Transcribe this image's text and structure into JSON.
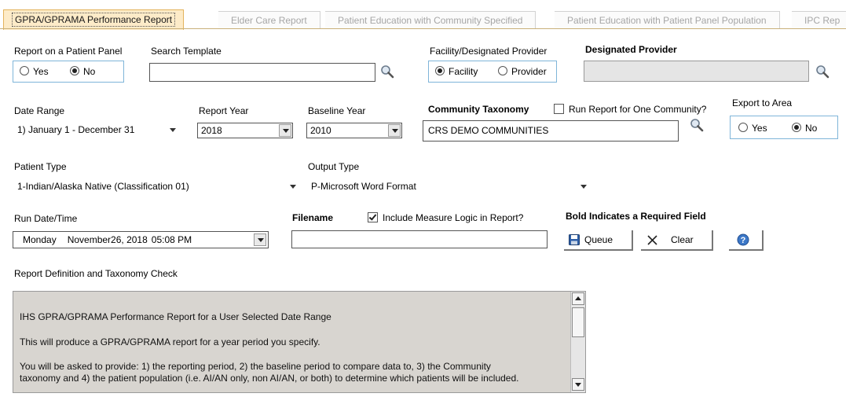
{
  "tabs": [
    {
      "label": "GPRA/GPRAMA Performance Report",
      "active": true
    },
    {
      "label": "Elder Care Report"
    },
    {
      "label": "Patient Education with Community Specified"
    },
    {
      "label": "Patient Education with Patient Panel Population"
    },
    {
      "label": "IPC Rep"
    }
  ],
  "panel": {
    "label": "Report on a Patient Panel",
    "yes": "Yes",
    "no": "No"
  },
  "search_template": {
    "label": "Search Template",
    "value": ""
  },
  "facility_provider": {
    "label": "Facility/Designated Provider",
    "facility": "Facility",
    "provider": "Provider"
  },
  "designated_provider": {
    "label": "Designated Provider",
    "value": ""
  },
  "date_range": {
    "label": "Date Range",
    "value": "1) January 1 - December 31"
  },
  "report_year": {
    "label": "Report Year",
    "value": "2018"
  },
  "baseline_year": {
    "label": "Baseline Year",
    "value": "2010"
  },
  "community_taxonomy": {
    "label": "Community Taxonomy",
    "run_one_label": "Run Report for One Community?",
    "value": "CRS DEMO COMMUNITIES"
  },
  "export_area": {
    "label": "Export to Area",
    "yes": "Yes",
    "no": "No"
  },
  "patient_type": {
    "label": "Patient Type",
    "value": "1-Indian/Alaska Native (Classification 01)"
  },
  "output_type": {
    "label": "Output Type",
    "value": "P-Microsoft Word Format"
  },
  "run_datetime": {
    "label": "Run Date/Time",
    "day": "Monday",
    "date": "November26, 2018",
    "time": "05:08 PM"
  },
  "filename": {
    "label": "Filename",
    "value": ""
  },
  "include_logic": {
    "label": "Include Measure Logic in Report?"
  },
  "required_note": "Bold Indicates a Required Field",
  "buttons": {
    "queue": "Queue",
    "clear": "Clear"
  },
  "definition": {
    "label": "Report Definition and Taxonomy Check",
    "lines": [
      "IHS GPRA/GPRAMA Performance Report for a User Selected Date Range",
      "This will produce a GPRA/GPRAMA report for a year period you specify.",
      "You will be asked to provide: 1) the reporting period, 2) the baseline period to compare data to, 3) the Community",
      "taxonomy and 4) the patient population (i.e. AI/AN only, non AI/AN, or both) to determine which patients will be included."
    ]
  },
  "colors": {
    "active_tab_bg": "#fdebc8",
    "active_tab_border": "#e3b35c",
    "radio_box_border": "#7fb5d9",
    "textarea_bg": "#d8d5d0"
  }
}
